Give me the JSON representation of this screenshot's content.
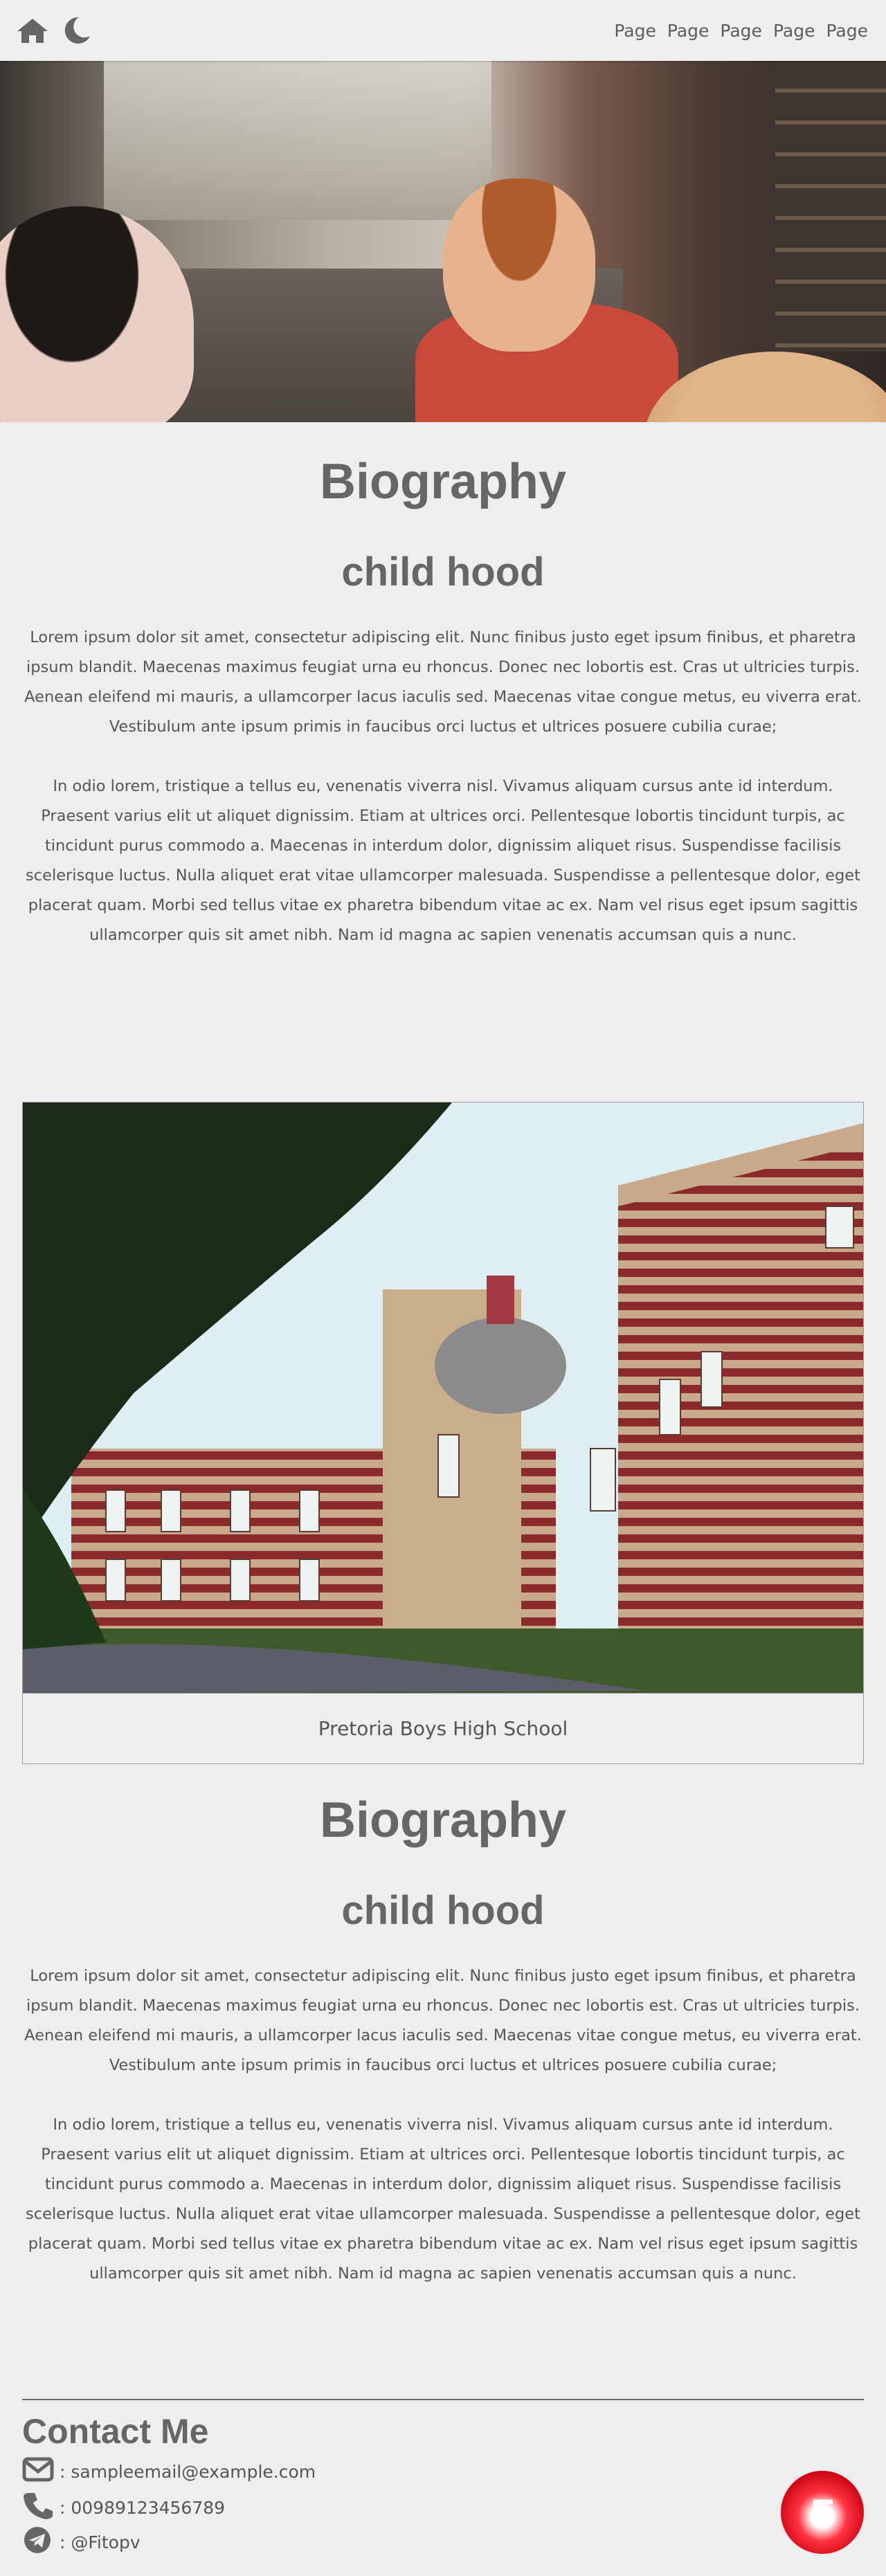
{
  "nav": {
    "links": [
      "Page",
      "Page",
      "Page",
      "Page",
      "Page"
    ]
  },
  "icons": {
    "home": "home-icon",
    "theme": "moon-icon",
    "email": "envelope-icon",
    "phone": "phone-icon",
    "telegram": "telegram-icon"
  },
  "sections": [
    {
      "title": "Biography",
      "subtitle": "child hood",
      "paragraphs": [
        "Lorem ipsum dolor sit amet, consectetur adipiscing elit. Nunc finibus justo eget ipsum finibus, et pharetra ipsum blandit. Maecenas maximus feugiat urna eu rhoncus. Donec nec lobortis est. Cras ut ultricies turpis. Aenean eleifend mi mauris, a ullamcorper lacus iaculis sed. Maecenas vitae congue metus, eu viverra erat. Vestibulum ante ipsum primis in faucibus orci luctus et ultrices posuere cubilia curae;",
        "In odio lorem, tristique a tellus eu, venenatis viverra nisl. Vivamus aliquam cursus ante id interdum. Praesent varius elit ut aliquet dignissim. Etiam at ultrices orci. Pellentesque lobortis tincidunt turpis, ac tincidunt purus commodo a. Maecenas in interdum dolor, dignissim aliquet risus. Suspendisse facilisis scelerisque luctus. Nulla aliquet erat vitae ullamcorper malesuada. Suspendisse a pellentesque dolor, eget placerat quam. Morbi sed tellus vitae ex pharetra bibendum vitae ac ex. Nam vel risus eget ipsum sagittis ullamcorper quis sit amet nibh. Nam id magna ac sapien venenatis accumsan quis a nunc."
      ]
    },
    {
      "title": "Biography",
      "subtitle": "child hood",
      "paragraphs": [
        "Lorem ipsum dolor sit amet, consectetur adipiscing elit. Nunc finibus justo eget ipsum finibus, et pharetra ipsum blandit. Maecenas maximus feugiat urna eu rhoncus. Donec nec lobortis est. Cras ut ultricies turpis. Aenean eleifend mi mauris, a ullamcorper lacus iaculis sed. Maecenas vitae congue metus, eu viverra erat. Vestibulum ante ipsum primis in faucibus orci luctus et ultrices posuere cubilia curae;",
        "In odio lorem, tristique a tellus eu, venenatis viverra nisl. Vivamus aliquam cursus ante id interdum. Praesent varius elit ut aliquet dignissim. Etiam at ultrices orci. Pellentesque lobortis tincidunt turpis, ac tincidunt purus commodo a. Maecenas in interdum dolor, dignissim aliquet risus. Suspendisse facilisis scelerisque luctus. Nulla aliquet erat vitae ullamcorper malesuada. Suspendisse a pellentesque dolor, eget placerat quam. Morbi sed tellus vitae ex pharetra bibendum vitae ac ex. Nam vel risus eget ipsum sagittis ullamcorper quis sit amet nibh. Nam id magna ac sapien venenatis accumsan quis a nunc."
      ]
    }
  ],
  "figure": {
    "caption": "Pretoria Boys High School"
  },
  "contact": {
    "title": "Contact Me",
    "email": ": sampleemail@example.com",
    "phone": ": 00989123456789",
    "telegram": ": @Fitopv"
  },
  "badge": {
    "letter": "F"
  },
  "colors": {
    "background": "#eeeeee",
    "text": "#666666",
    "badge_red": "#ff1a2b"
  }
}
